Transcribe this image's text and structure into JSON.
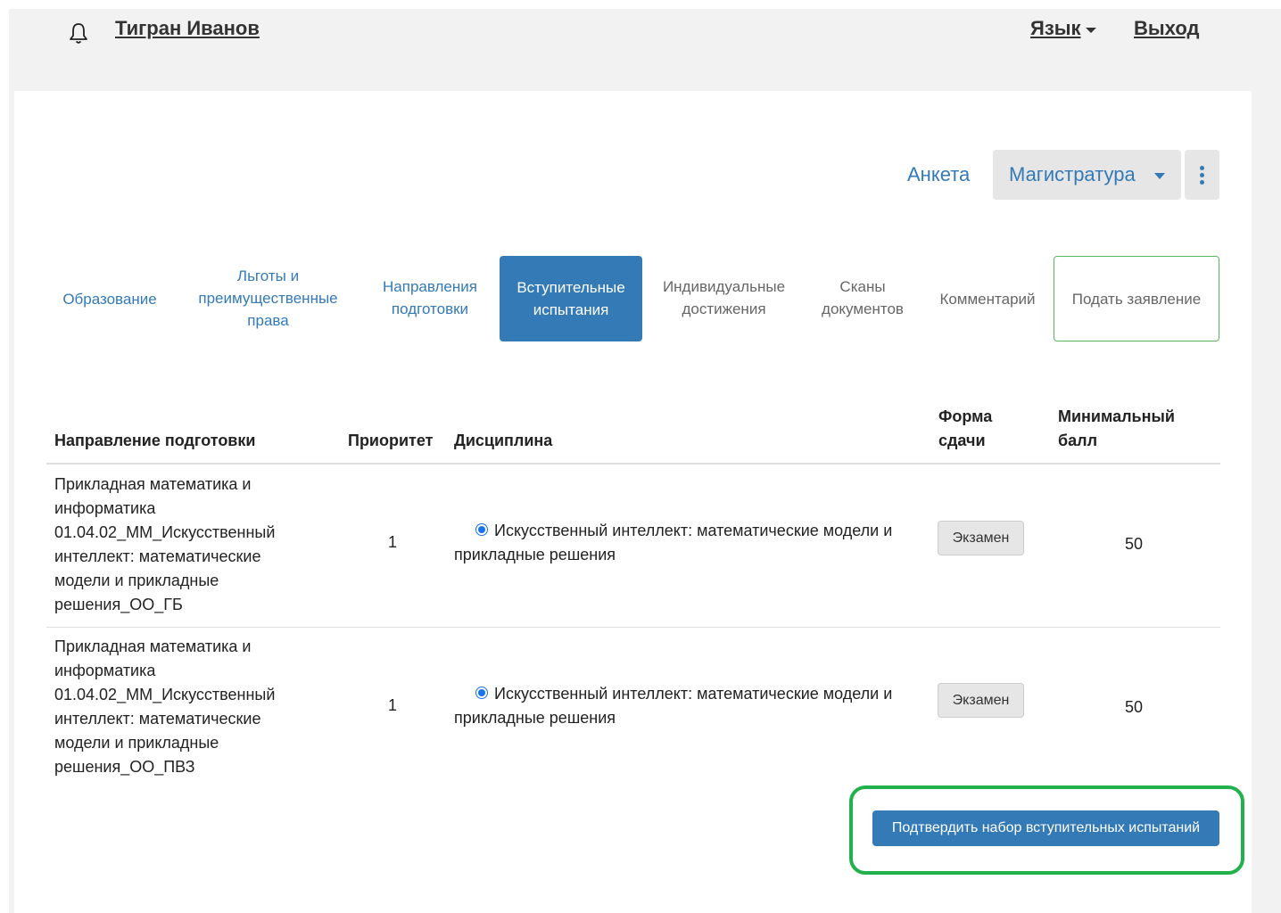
{
  "header": {
    "user_name": "Тигран Иванов",
    "language_label": "Язык",
    "logout_label": "Выход",
    "bell_icon": "bell-icon"
  },
  "top_actions": {
    "anketa_label": "Анкета",
    "program_label": "Магистратура",
    "kebab_icon": "vertical-dots-icon"
  },
  "tabs": [
    {
      "label": "Образование"
    },
    {
      "label": "Льготы и\nпреимущественные\nправа"
    },
    {
      "label": "Направления\nподготовки"
    },
    {
      "label": "Вступительные\nиспытания",
      "active": true
    },
    {
      "label": "Индивидуальные\nдостижения"
    },
    {
      "label": "Сканы\nдокументов"
    },
    {
      "label": "Комментарий"
    },
    {
      "label": "Подать заявление"
    }
  ],
  "table": {
    "headers": {
      "direction": "Направление подготовки",
      "priority": "Приоритет",
      "discipline": "Дисциплина",
      "form": "Форма\nсдачи",
      "min_score": "Минимальный\nбалл"
    },
    "rows": [
      {
        "direction": "Прикладная математика и\nинформатика\n01.04.02_ММ_Искусственный\nинтеллект: математические\nмодели и прикладные\nрешения_ОО_ГБ",
        "priority": "1",
        "discipline": "Искусственный интеллект: математические модели и прикладные решения",
        "form": "Экзамен",
        "min_score": "50"
      },
      {
        "direction": "Прикладная математика и\nинформатика\n01.04.02_ММ_Искусственный\nинтеллект: математические\nмодели и прикладные\nрешения_ОО_ПВЗ",
        "priority": "1",
        "discipline": "Искусственный интеллект: математические модели и прикладные решения",
        "form": "Экзамен",
        "min_score": "50"
      }
    ]
  },
  "confirm_label": "Подтвердить набор вступительных испытаний",
  "colors": {
    "accent": "#337ab7",
    "highlight": "#22b14c",
    "submit_border": "#5cb85c"
  }
}
